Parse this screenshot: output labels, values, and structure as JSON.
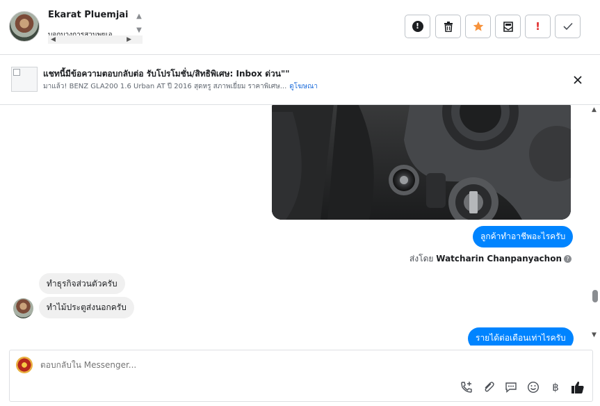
{
  "header": {
    "contact_name": "Ekarat Pluemjai",
    "contact_subtitle": "บจกบางการสวนพยูเอ",
    "buttons": {
      "mark_unread": "Mark as unread",
      "delete": "Delete",
      "star": "Star",
      "archive": "Archive",
      "spam": "Mark as spam",
      "done": "Mark as done"
    }
  },
  "banner": {
    "title": "แชทนี้มีข้อความตอบกลับต่อ รับโปรโมชั่น/สิทธิพิเศษ: Inbox ด่วน\"\"",
    "description": "มาแล้ว! BENZ GLA200 1.6 Urban AT ปี 2016 สุดหรู สภาพเยี่ยม ราคาพิเศษ...",
    "link": "ดูโฆษณา"
  },
  "conversation": {
    "messages": [
      {
        "direction": "out",
        "text": "ลูกค้าทำอาชีพอะไรครับ"
      },
      {
        "direction": "in",
        "text": "ทำธุรกิจส่วนตัวครับ"
      },
      {
        "direction": "in",
        "text": "ทำไม้ประตูส่งนอกครับ"
      },
      {
        "direction": "out",
        "text": "รายได้ต่อเดือนเท่าไรครับ"
      }
    ],
    "sent_by_prefix": "ส่งโดย",
    "sent_by_name": "Watcharin Chanpanyachon"
  },
  "composer": {
    "placeholder": "ตอบกลับใน Messenger..."
  },
  "colors": {
    "outgoing_bubble": "#0084ff",
    "incoming_bubble": "#f0f0f0",
    "star_accent": "#f7923b",
    "spam_accent": "#e02c2c",
    "link": "#216fdb"
  },
  "icons": {
    "mark_unread": "exclamation-circle-icon",
    "delete": "trash-icon",
    "star": "star-icon",
    "archive": "archive-icon",
    "spam": "exclamation-icon",
    "done": "check-icon",
    "close": "close-icon",
    "call": "phone-add-icon",
    "attach": "paperclip-icon",
    "saved_replies": "chat-bubble-icon",
    "emoji": "smiley-icon",
    "payment": "baht-icon",
    "like": "thumbs-up-icon"
  }
}
